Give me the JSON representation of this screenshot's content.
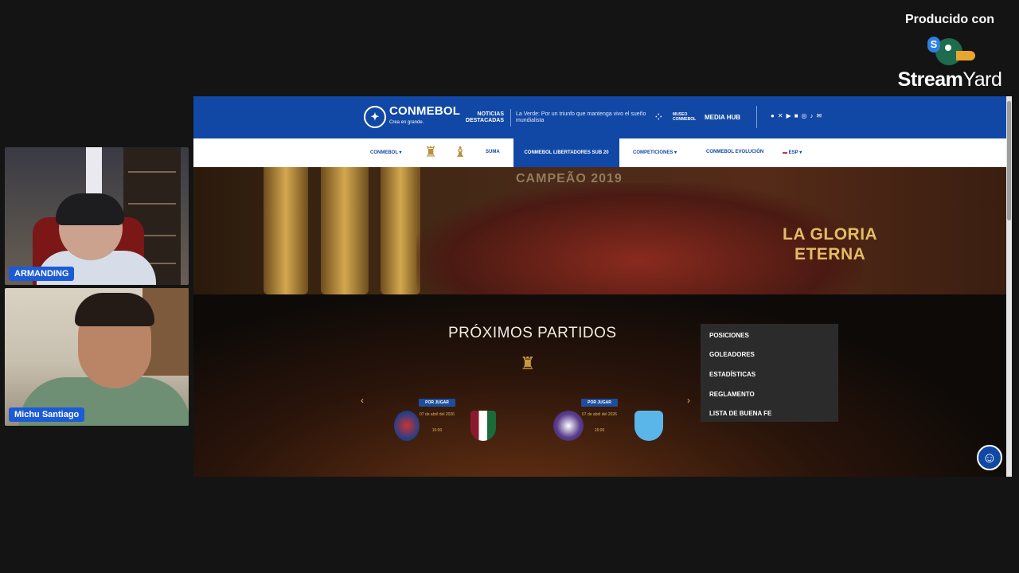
{
  "participants": [
    {
      "name": "ARMANDING"
    },
    {
      "name": "Michu Santiago"
    }
  ],
  "branding": {
    "produced_with": "Producido con",
    "brand_name_bold": "Stream",
    "brand_name_regular": "Yard",
    "brand_badge": "S"
  },
  "website": {
    "logo_text": "CONMEBOL",
    "logo_tagline": "Crea en grande.",
    "news_heading": "NOTICIAS DESTACADAS",
    "news_text": "La Verde: Por un triunfo que mantenga vivo el sueño mundialista",
    "museo_label": "MUSEO CONMEBOL",
    "media_hub": "MEDIA HUB",
    "social_icons": [
      "facebook-icon",
      "x-icon",
      "youtube-icon",
      "linkedin-icon",
      "instagram-icon",
      "tiktok-icon",
      "mail-icon"
    ],
    "nav": {
      "conmebol": "CONMEBOL",
      "suma": "SUMA",
      "active": "CONMEBOL LIBERTADORES SUB 20",
      "competiciones": "COMPETICIONES",
      "evolucion": "CONMEBOL EVOLUCIÓN",
      "language": "ESP"
    },
    "hero": {
      "banner": "CAMPEÃO 2019",
      "title_line1": "LA GLORIA",
      "title_line2": "ETERNA"
    },
    "upcoming": {
      "title": "PRÓXIMOS PARTIDOS",
      "matches": [
        {
          "status": "POR JUGAR",
          "date": "07 de abril del 2026",
          "time": "16:00"
        },
        {
          "status": "POR JUGAR",
          "date": "07 de abril del 2026",
          "time": "16:00"
        }
      ]
    },
    "dropdown": [
      "POSICIONES",
      "GOLEADORES",
      "ESTADÍSTICAS",
      "REGLAMENTO",
      "LISTA DE BUENA FE"
    ]
  },
  "colors": {
    "conmebol_blue": "#1148a5",
    "gold": "#e2bd62",
    "label_blue": "#1c5bd6"
  }
}
